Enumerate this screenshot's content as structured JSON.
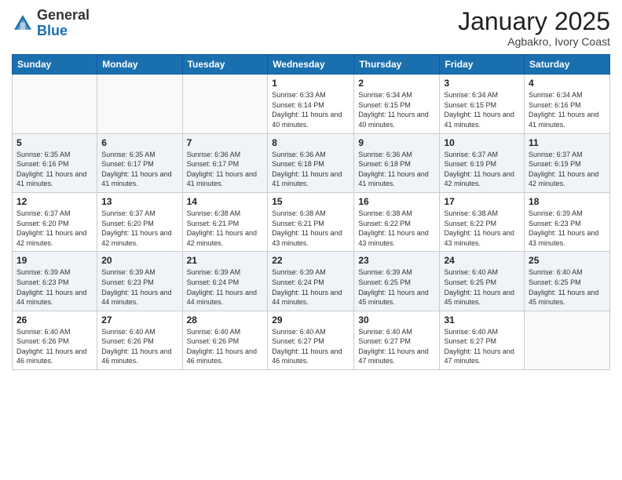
{
  "logo": {
    "general": "General",
    "blue": "Blue"
  },
  "header": {
    "month": "January 2025",
    "location": "Agbakro, Ivory Coast"
  },
  "weekdays": [
    "Sunday",
    "Monday",
    "Tuesday",
    "Wednesday",
    "Thursday",
    "Friday",
    "Saturday"
  ],
  "weeks": [
    [
      {
        "day": "",
        "sunrise": "",
        "sunset": "",
        "daylight": ""
      },
      {
        "day": "",
        "sunrise": "",
        "sunset": "",
        "daylight": ""
      },
      {
        "day": "",
        "sunrise": "",
        "sunset": "",
        "daylight": ""
      },
      {
        "day": "1",
        "sunrise": "Sunrise: 6:33 AM",
        "sunset": "Sunset: 6:14 PM",
        "daylight": "Daylight: 11 hours and 40 minutes."
      },
      {
        "day": "2",
        "sunrise": "Sunrise: 6:34 AM",
        "sunset": "Sunset: 6:15 PM",
        "daylight": "Daylight: 11 hours and 40 minutes."
      },
      {
        "day": "3",
        "sunrise": "Sunrise: 6:34 AM",
        "sunset": "Sunset: 6:15 PM",
        "daylight": "Daylight: 11 hours and 41 minutes."
      },
      {
        "day": "4",
        "sunrise": "Sunrise: 6:34 AM",
        "sunset": "Sunset: 6:16 PM",
        "daylight": "Daylight: 11 hours and 41 minutes."
      }
    ],
    [
      {
        "day": "5",
        "sunrise": "Sunrise: 6:35 AM",
        "sunset": "Sunset: 6:16 PM",
        "daylight": "Daylight: 11 hours and 41 minutes."
      },
      {
        "day": "6",
        "sunrise": "Sunrise: 6:35 AM",
        "sunset": "Sunset: 6:17 PM",
        "daylight": "Daylight: 11 hours and 41 minutes."
      },
      {
        "day": "7",
        "sunrise": "Sunrise: 6:36 AM",
        "sunset": "Sunset: 6:17 PM",
        "daylight": "Daylight: 11 hours and 41 minutes."
      },
      {
        "day": "8",
        "sunrise": "Sunrise: 6:36 AM",
        "sunset": "Sunset: 6:18 PM",
        "daylight": "Daylight: 11 hours and 41 minutes."
      },
      {
        "day": "9",
        "sunrise": "Sunrise: 6:36 AM",
        "sunset": "Sunset: 6:18 PM",
        "daylight": "Daylight: 11 hours and 41 minutes."
      },
      {
        "day": "10",
        "sunrise": "Sunrise: 6:37 AM",
        "sunset": "Sunset: 6:19 PM",
        "daylight": "Daylight: 11 hours and 42 minutes."
      },
      {
        "day": "11",
        "sunrise": "Sunrise: 6:37 AM",
        "sunset": "Sunset: 6:19 PM",
        "daylight": "Daylight: 11 hours and 42 minutes."
      }
    ],
    [
      {
        "day": "12",
        "sunrise": "Sunrise: 6:37 AM",
        "sunset": "Sunset: 6:20 PM",
        "daylight": "Daylight: 11 hours and 42 minutes."
      },
      {
        "day": "13",
        "sunrise": "Sunrise: 6:37 AM",
        "sunset": "Sunset: 6:20 PM",
        "daylight": "Daylight: 11 hours and 42 minutes."
      },
      {
        "day": "14",
        "sunrise": "Sunrise: 6:38 AM",
        "sunset": "Sunset: 6:21 PM",
        "daylight": "Daylight: 11 hours and 42 minutes."
      },
      {
        "day": "15",
        "sunrise": "Sunrise: 6:38 AM",
        "sunset": "Sunset: 6:21 PM",
        "daylight": "Daylight: 11 hours and 43 minutes."
      },
      {
        "day": "16",
        "sunrise": "Sunrise: 6:38 AM",
        "sunset": "Sunset: 6:22 PM",
        "daylight": "Daylight: 11 hours and 43 minutes."
      },
      {
        "day": "17",
        "sunrise": "Sunrise: 6:38 AM",
        "sunset": "Sunset: 6:22 PM",
        "daylight": "Daylight: 11 hours and 43 minutes."
      },
      {
        "day": "18",
        "sunrise": "Sunrise: 6:39 AM",
        "sunset": "Sunset: 6:23 PM",
        "daylight": "Daylight: 11 hours and 43 minutes."
      }
    ],
    [
      {
        "day": "19",
        "sunrise": "Sunrise: 6:39 AM",
        "sunset": "Sunset: 6:23 PM",
        "daylight": "Daylight: 11 hours and 44 minutes."
      },
      {
        "day": "20",
        "sunrise": "Sunrise: 6:39 AM",
        "sunset": "Sunset: 6:23 PM",
        "daylight": "Daylight: 11 hours and 44 minutes."
      },
      {
        "day": "21",
        "sunrise": "Sunrise: 6:39 AM",
        "sunset": "Sunset: 6:24 PM",
        "daylight": "Daylight: 11 hours and 44 minutes."
      },
      {
        "day": "22",
        "sunrise": "Sunrise: 6:39 AM",
        "sunset": "Sunset: 6:24 PM",
        "daylight": "Daylight: 11 hours and 44 minutes."
      },
      {
        "day": "23",
        "sunrise": "Sunrise: 6:39 AM",
        "sunset": "Sunset: 6:25 PM",
        "daylight": "Daylight: 11 hours and 45 minutes."
      },
      {
        "day": "24",
        "sunrise": "Sunrise: 6:40 AM",
        "sunset": "Sunset: 6:25 PM",
        "daylight": "Daylight: 11 hours and 45 minutes."
      },
      {
        "day": "25",
        "sunrise": "Sunrise: 6:40 AM",
        "sunset": "Sunset: 6:25 PM",
        "daylight": "Daylight: 11 hours and 45 minutes."
      }
    ],
    [
      {
        "day": "26",
        "sunrise": "Sunrise: 6:40 AM",
        "sunset": "Sunset: 6:26 PM",
        "daylight": "Daylight: 11 hours and 46 minutes."
      },
      {
        "day": "27",
        "sunrise": "Sunrise: 6:40 AM",
        "sunset": "Sunset: 6:26 PM",
        "daylight": "Daylight: 11 hours and 46 minutes."
      },
      {
        "day": "28",
        "sunrise": "Sunrise: 6:40 AM",
        "sunset": "Sunset: 6:26 PM",
        "daylight": "Daylight: 11 hours and 46 minutes."
      },
      {
        "day": "29",
        "sunrise": "Sunrise: 6:40 AM",
        "sunset": "Sunset: 6:27 PM",
        "daylight": "Daylight: 11 hours and 46 minutes."
      },
      {
        "day": "30",
        "sunrise": "Sunrise: 6:40 AM",
        "sunset": "Sunset: 6:27 PM",
        "daylight": "Daylight: 11 hours and 47 minutes."
      },
      {
        "day": "31",
        "sunrise": "Sunrise: 6:40 AM",
        "sunset": "Sunset: 6:27 PM",
        "daylight": "Daylight: 11 hours and 47 minutes."
      },
      {
        "day": "",
        "sunrise": "",
        "sunset": "",
        "daylight": ""
      }
    ]
  ]
}
